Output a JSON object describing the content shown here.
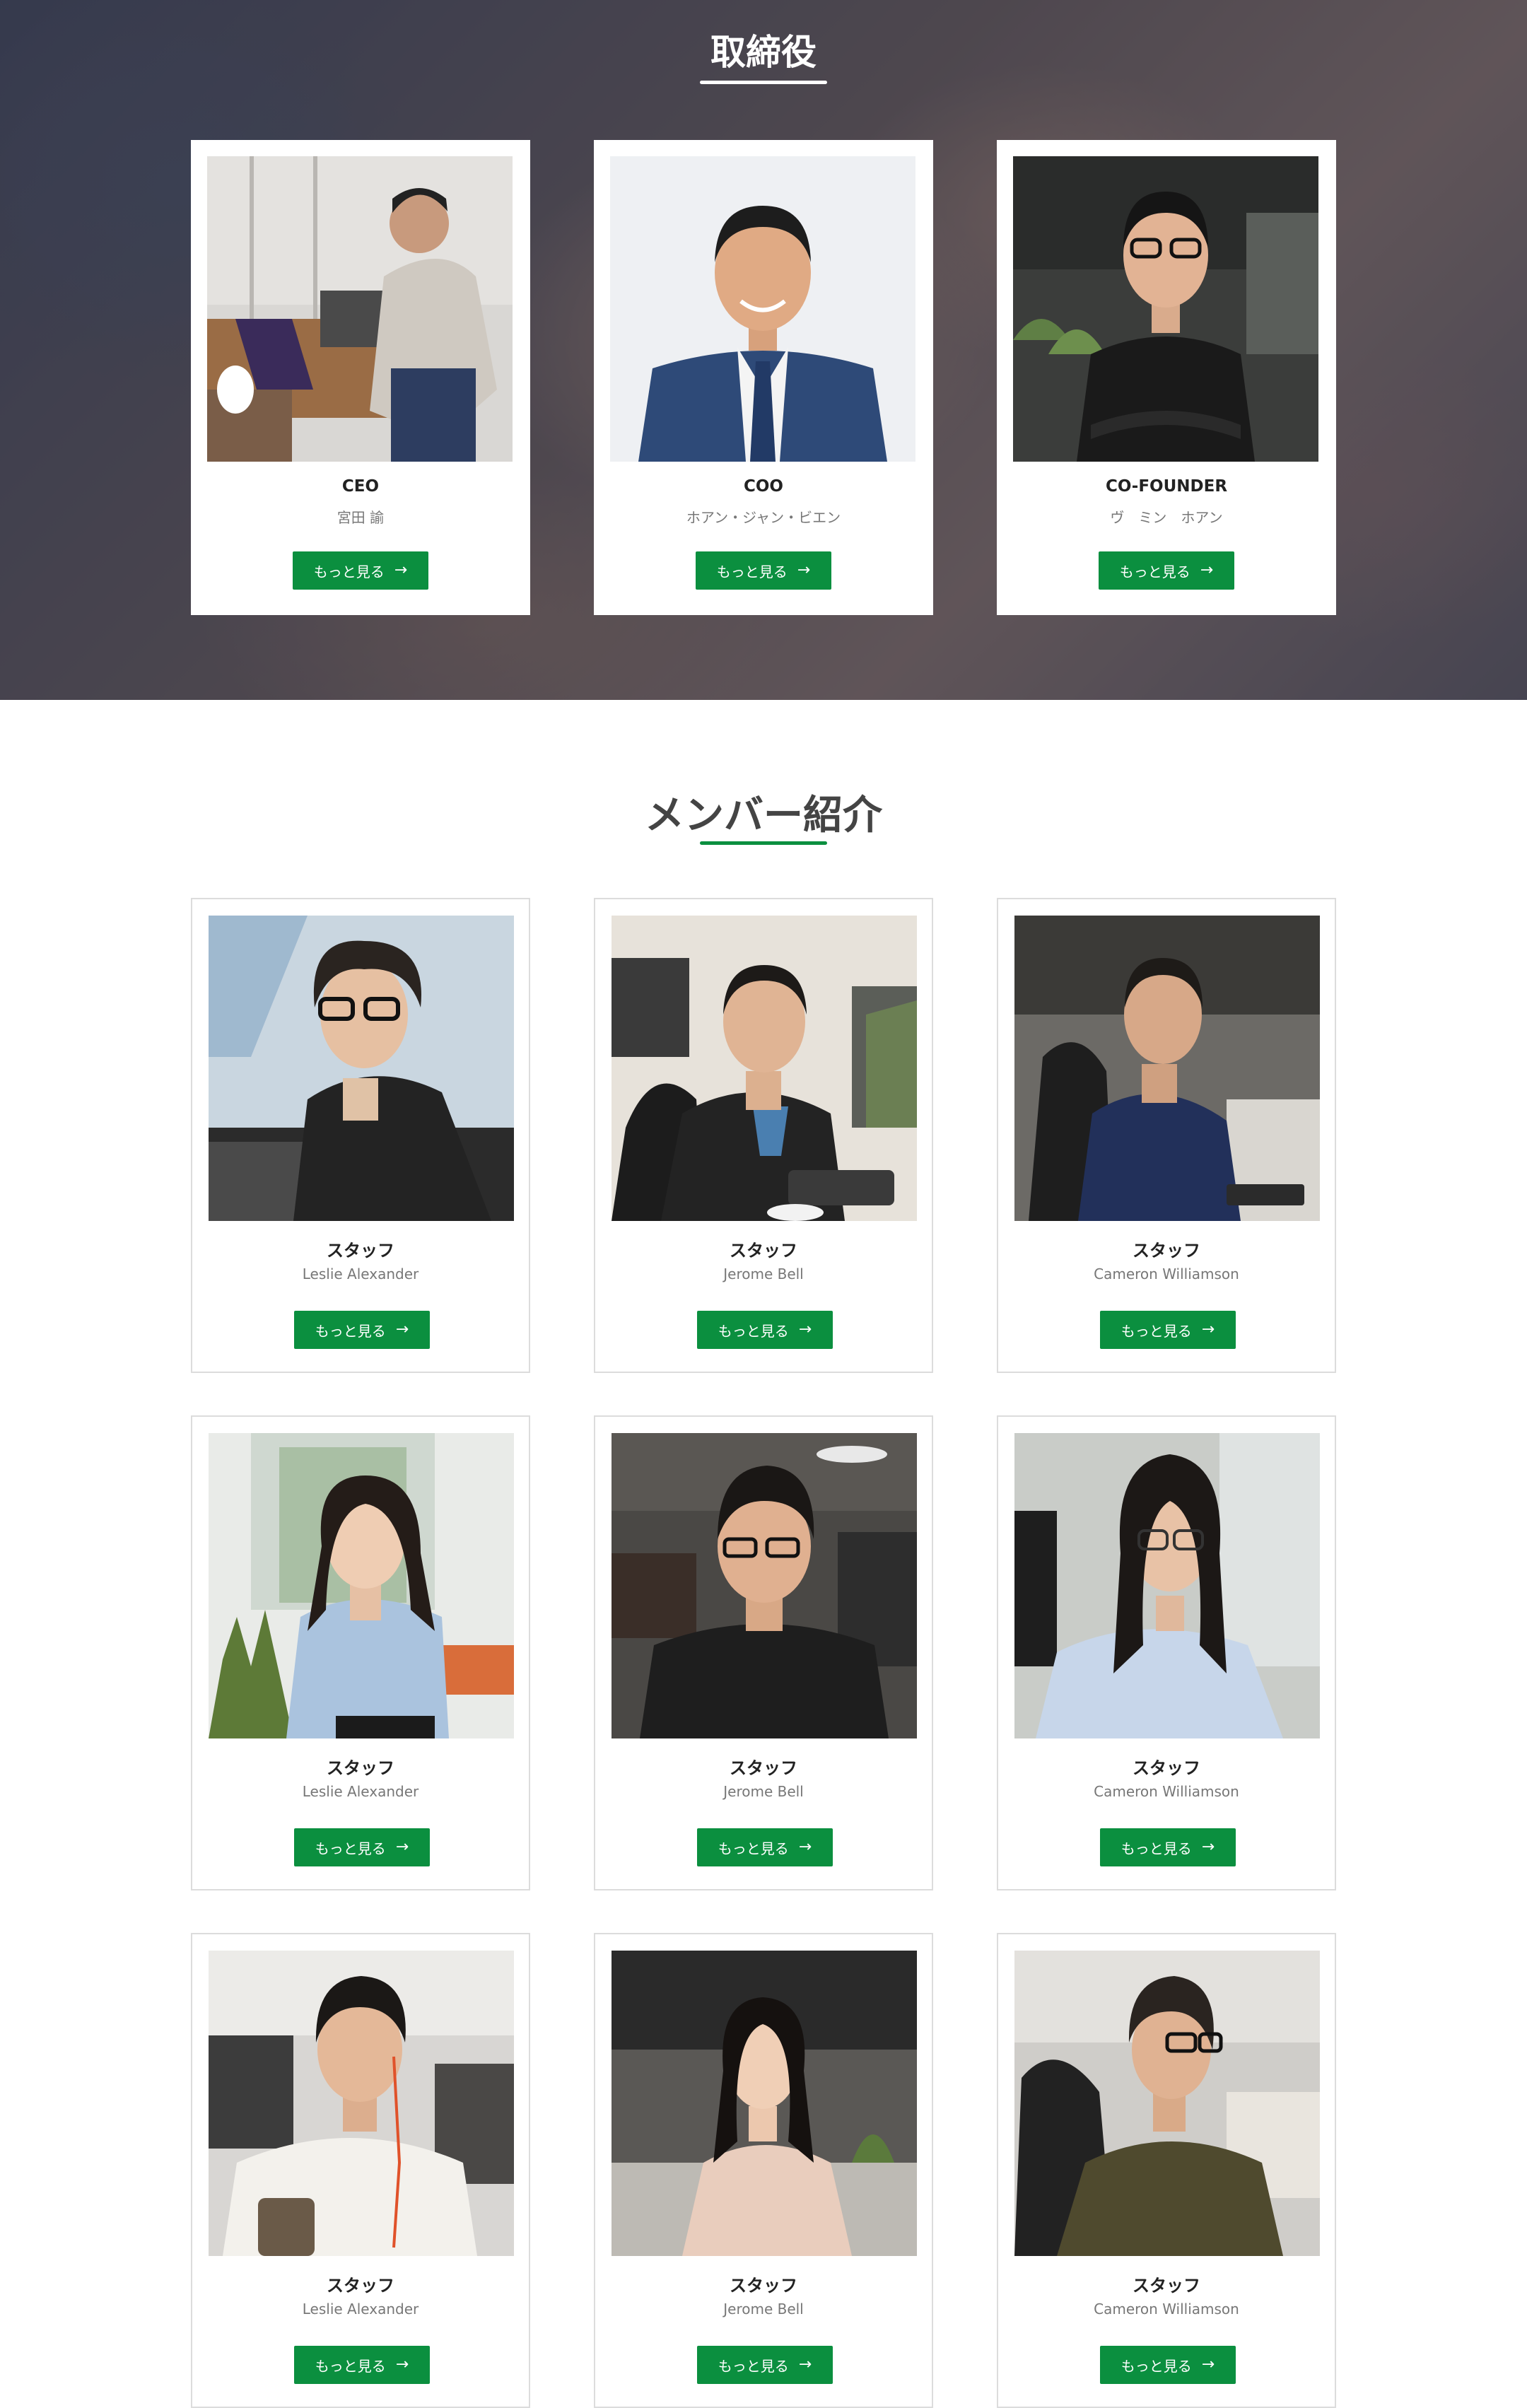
{
  "executives": {
    "title": "取締役",
    "cards": [
      {
        "role": "CEO",
        "name": "宮田 諭",
        "button": "もっと見る",
        "photo": "ceo-photo"
      },
      {
        "role": "COO",
        "name": "ホアン・ジャン・ビエン",
        "button": "もっと見る",
        "photo": "coo-photo"
      },
      {
        "role": "CO-FOUNDER",
        "name": "ヴ　ミン　ホアン",
        "button": "もっと見る",
        "photo": "cofounder-photo"
      }
    ]
  },
  "members": {
    "title": "メンバー紹介",
    "cards": [
      {
        "role": "スタッフ",
        "name": "Leslie Alexander",
        "button": "もっと見る"
      },
      {
        "role": "スタッフ",
        "name": "Jerome Bell",
        "button": "もっと見る"
      },
      {
        "role": "スタッフ",
        "name": "Cameron Williamson",
        "button": "もっと見る"
      },
      {
        "role": "スタッフ",
        "name": "Leslie Alexander",
        "button": "もっと見る"
      },
      {
        "role": "スタッフ",
        "name": "Jerome Bell",
        "button": "もっと見る"
      },
      {
        "role": "スタッフ",
        "name": "Cameron Williamson",
        "button": "もっと見る"
      },
      {
        "role": "スタッフ",
        "name": "Leslie Alexander",
        "button": "もっと見る"
      },
      {
        "role": "スタッフ",
        "name": "Jerome Bell",
        "button": "もっと見る"
      },
      {
        "role": "スタッフ",
        "name": "Cameron Williamson",
        "button": "もっと見る"
      }
    ]
  },
  "icons": {
    "button_arrow": "arrow-right-icon"
  },
  "colors": {
    "accent": "#0b8f3f",
    "card_border": "#dcdcdc",
    "title_light": "#ffffff"
  }
}
